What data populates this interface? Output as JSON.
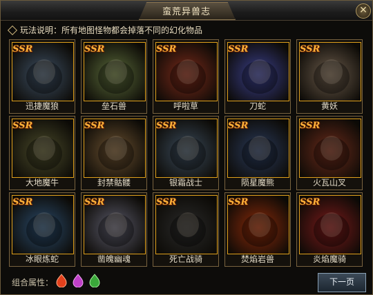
{
  "window": {
    "title": "蛮荒异兽志",
    "close_label": "✕"
  },
  "rules": {
    "text": "玩法说明：所有地图怪物都会掉落不同的幻化物品"
  },
  "badge": "SSR",
  "cards": [
    {
      "name": "迅捷魔狼",
      "hue": "#3d4f63"
    },
    {
      "name": "垒石兽",
      "hue": "#5a6a3a"
    },
    {
      "name": "呼啦草",
      "hue": "#7a2a1a"
    },
    {
      "name": "刀蛇",
      "hue": "#3a3f8a"
    },
    {
      "name": "黄妖",
      "hue": "#6a5a4a"
    },
    {
      "name": "大地魔牛",
      "hue": "#4a4a2a"
    },
    {
      "name": "封禁骷髅",
      "hue": "#6a5030"
    },
    {
      "name": "银霜战士",
      "hue": "#3a4a5a"
    },
    {
      "name": "陨星魔熊",
      "hue": "#2a3a5a"
    },
    {
      "name": "火瓦山叉",
      "hue": "#6a2a1a"
    },
    {
      "name": "冰眼炼蛇",
      "hue": "#2a4a6a"
    },
    {
      "name": "凿魄幽魂",
      "hue": "#5a5a6a"
    },
    {
      "name": "死亡战骑",
      "hue": "#2a2a2a"
    },
    {
      "name": "焚焰岩兽",
      "hue": "#8a2a0a"
    },
    {
      "name": "炎焰魔骑",
      "hue": "#7a1a1a"
    }
  ],
  "footer": {
    "combo_label": "组合属性：",
    "gems": [
      {
        "name": "fire-gem-icon",
        "color": "#e2401c"
      },
      {
        "name": "poison-gem-icon",
        "color": "#c040c8"
      },
      {
        "name": "nature-gem-icon",
        "color": "#3aa83a"
      }
    ],
    "next_label": "下一页"
  }
}
